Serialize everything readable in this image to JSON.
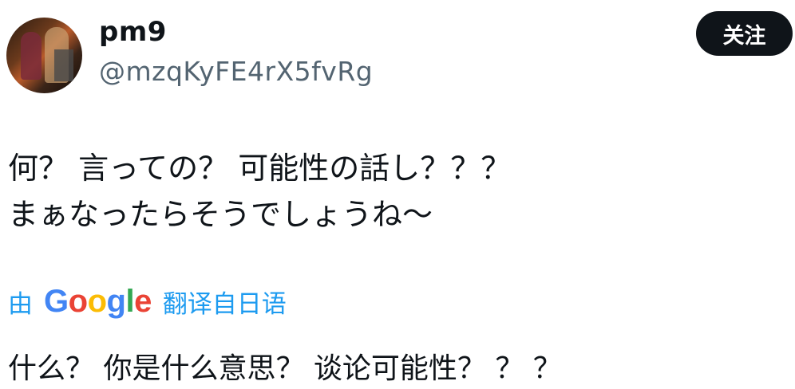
{
  "user": {
    "display_name": "pm9",
    "handle": "@mzqKyFE4rX5fvRg"
  },
  "follow_button": {
    "label": "关注"
  },
  "tweet": {
    "lines": [
      "何？ 言っての？ 可能性の話し？？？",
      "まぁなったらそうでしょうね～"
    ]
  },
  "translation": {
    "by_label": "由",
    "provider": "Google",
    "provider_letters": [
      "G",
      "o",
      "o",
      "g",
      "l",
      "e"
    ],
    "link_label": "翻译自日语",
    "text": "什么？ 你是什么意思？ 谈论可能性？ ？ ？"
  },
  "colors": {
    "link": "#1d9bf0",
    "handle": "#536471",
    "text": "#0f1419",
    "button_bg": "#0f1419"
  }
}
